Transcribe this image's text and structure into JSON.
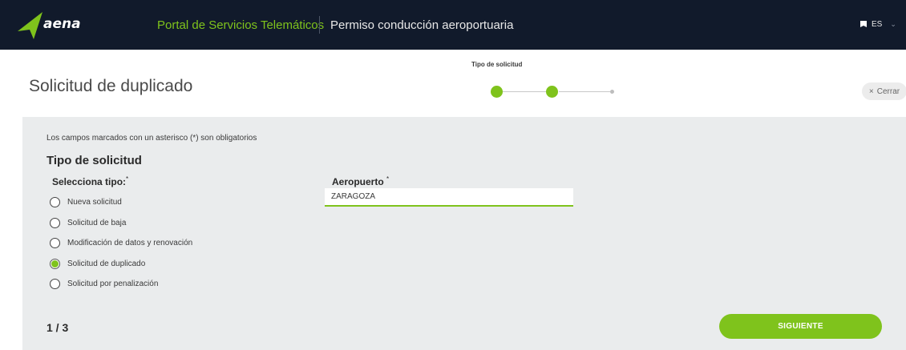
{
  "header": {
    "logo_text": "aena",
    "portal_title": "Portal de Servicios Telemáticos",
    "app_title": "Permiso conducción aeroportuaria",
    "language": "ES",
    "flag_icon": "flag-icon",
    "chevron_icon": "chevron-down-icon"
  },
  "page": {
    "title": "Solicitud de duplicado",
    "close_label": "Cerrar"
  },
  "stepper": {
    "current_label": "Tipo de solicitud",
    "total_steps": 3,
    "completed_steps": 2
  },
  "form": {
    "required_note": "Los campos marcados con un asterisco (*) son obligatorios",
    "section_title": "Tipo de solicitud",
    "type_label": "Selecciona tipo:",
    "type_required": "*",
    "options": [
      {
        "label": "Nueva solicitud",
        "checked": false
      },
      {
        "label": "Solicitud de baja",
        "checked": false
      },
      {
        "label": "Modificación de datos y renovación",
        "checked": false
      },
      {
        "label": "Solicitud de duplicado",
        "checked": true
      },
      {
        "label": "Solicitud por penalización",
        "checked": false
      }
    ],
    "airport_label": "Aeropuerto",
    "airport_required": "*",
    "airport_value": "ZARAGOZA"
  },
  "footer": {
    "page_count": "1 / 3",
    "next_label": "SIGUIENTE"
  },
  "colors": {
    "brand_green": "#7fc31c",
    "header_bg": "#111a2b",
    "panel_bg": "#eaeced"
  }
}
